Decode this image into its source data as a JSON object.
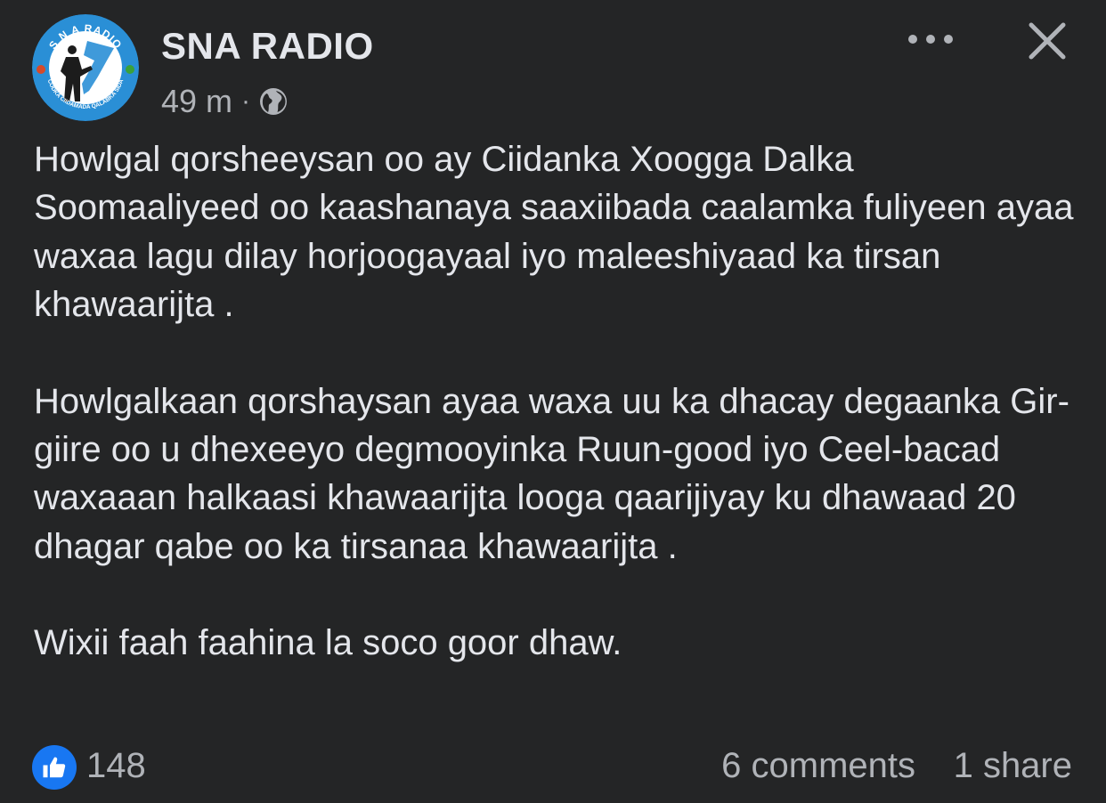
{
  "post": {
    "author": "SNA RADIO",
    "time": "49 m",
    "separator": "·",
    "audience_icon": "globe-icon",
    "avatar": {
      "top_text": "S N A RADIO",
      "bottom_text": "CODKA CIIDAMADA QALABKA SIDA",
      "colors": {
        "ring": "#2a8fd6",
        "inner": "#ffffff",
        "text": "#ffffff"
      }
    },
    "paragraphs": [
      "Howlgal qorsheeysan oo ay Ciidanka Xoogga Dalka Soomaaliyeed oo kaashanaya saaxiibada caalamka fuliyeen ayaa waxaa lagu dilay horjoogayaal iyo maleeshiyaad ka tirsan khawaarijta .",
      "Howlgalkaan qorshaysan ayaa waxa uu ka dhacay degaanka Gir-giire oo u dhexeeyo degmooyinka Ruun-good iyo Ceel-bacad  waxaaan halkaasi khawaarijta looga qaarijiyay ku dhawaad 20 dhagar qabe oo ka tirsanaa khawaarijta .",
      "Wixii faah faahina la soco goor dhaw."
    ],
    "reactions": {
      "icon": "thumbs-up-icon",
      "count": "148"
    },
    "comments": "6 comments",
    "shares": "1 share"
  },
  "icons": {
    "more": "more-horizontal-icon",
    "close": "close-icon"
  },
  "colors": {
    "background": "#242526",
    "text": "#e4e6eb",
    "secondary": "#b0b3b8",
    "accent": "#1877f2"
  }
}
